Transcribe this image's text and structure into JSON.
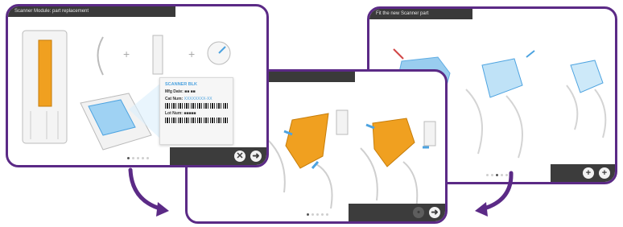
{
  "colors": {
    "frame": "#5b2a86",
    "toolbar": "#3c3c3c",
    "accent_orange": "#f0a020",
    "accent_blue": "#4da3e0",
    "arrow": "#5b2a86"
  },
  "panels": [
    {
      "title": "Scanner Module: part replacement",
      "dots": 5,
      "active_dot": 0,
      "buttons": [
        {
          "icon": "close-icon",
          "glyph": "✕"
        },
        {
          "icon": "next-icon",
          "glyph": "➜"
        }
      ],
      "card": {
        "title": "SCANNER BLK",
        "fields": [
          {
            "label": "Mfg Date:",
            "value": "■■ ■■"
          },
          {
            "label": "Cat Num:",
            "value": "XXXXXXXX-XX"
          },
          {
            "label": "Lot Num:",
            "value": "■■■■■"
          }
        ]
      }
    },
    {
      "title": "",
      "dots": 5,
      "active_dot": 0,
      "buttons": [
        {
          "icon": "back-icon",
          "glyph": "•"
        },
        {
          "icon": "next-icon",
          "glyph": "➜"
        }
      ]
    },
    {
      "title": "Fit the new Scanner part",
      "dots": 5,
      "active_dot": 2,
      "buttons": [
        {
          "icon": "add-icon",
          "glyph": "+"
        },
        {
          "icon": "add-icon",
          "glyph": "+"
        }
      ]
    }
  ]
}
